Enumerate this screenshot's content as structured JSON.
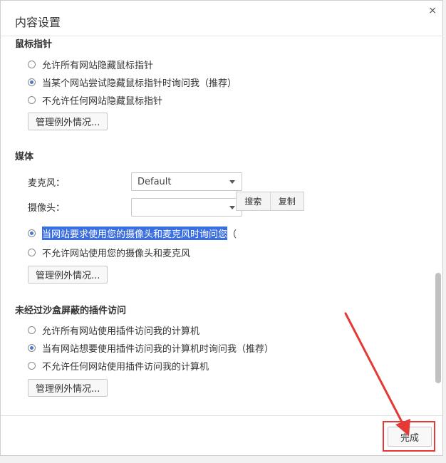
{
  "dialog": {
    "title": "内容设置",
    "close_glyph": "×"
  },
  "sections": {
    "mouse_pointer": {
      "title": "鼠标指针",
      "options": [
        {
          "label": "允许所有网站隐藏鼠标指针",
          "checked": false
        },
        {
          "label": "当某个网站尝试隐藏鼠标指针时询问我（推荐）",
          "checked": true
        },
        {
          "label": "不允许任何网站隐藏鼠标指针",
          "checked": false
        }
      ],
      "manage_label": "管理例外情况..."
    },
    "media": {
      "title": "媒体",
      "mic_label": "麦克风：",
      "mic_value": "Default",
      "camera_label": "摄像头：",
      "camera_value": "",
      "options": [
        {
          "label": "当网站要求使用您的摄像头和麦克风时询问您",
          "suffix": "（",
          "checked": true
        },
        {
          "label": "不允许网站使用您的摄像头和麦克风",
          "checked": false
        }
      ],
      "context_menu": {
        "search": "搜索",
        "copy": "复制"
      },
      "manage_label": "管理例外情况..."
    },
    "plugins": {
      "title": "未经过沙盒屏蔽的插件访问",
      "options": [
        {
          "label": "允许所有网站使用插件访问我的计算机",
          "checked": false
        },
        {
          "label": "当有网站想要使用插件访问我的计算机时询问我（推荐）",
          "checked": true
        },
        {
          "label": "不允许任何网站使用插件访问我的计算机",
          "checked": false
        }
      ],
      "manage_label": "管理例外情况..."
    }
  },
  "footer": {
    "done_label": "完成"
  },
  "colors": {
    "annotation_red": "#e53935",
    "selection_blue": "#3b6ee0"
  }
}
